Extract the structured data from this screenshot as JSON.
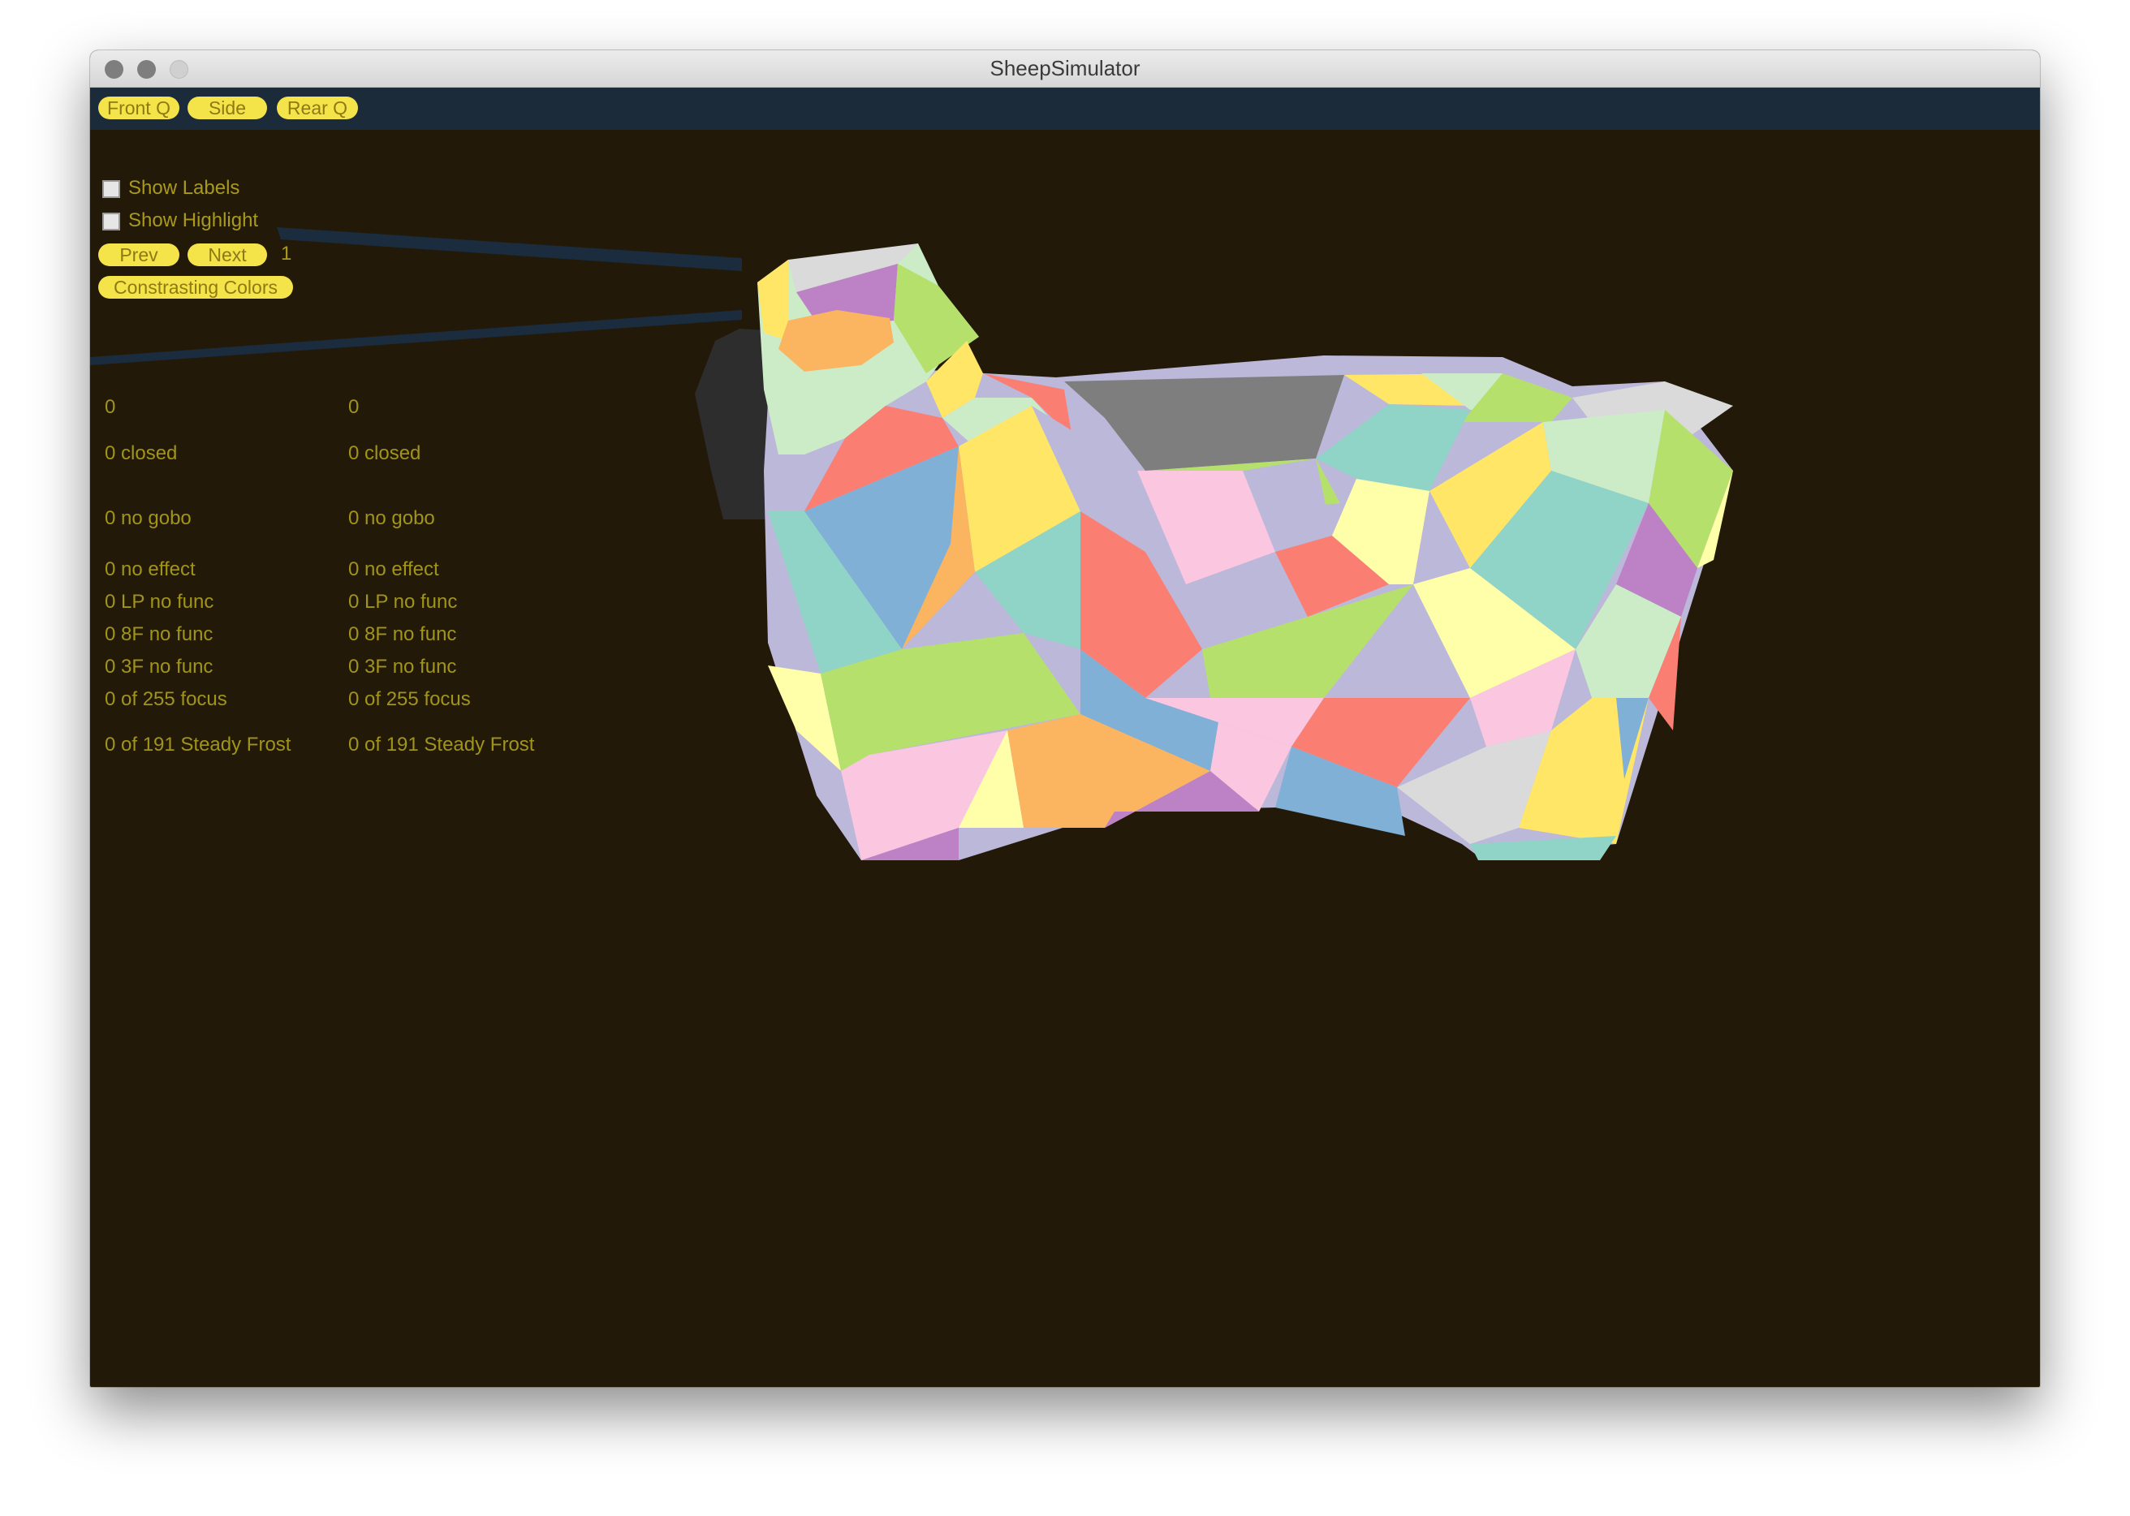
{
  "window": {
    "title": "SheepSimulator"
  },
  "toolbar": {
    "buttons": [
      "Front Q",
      "Side",
      "Rear Q"
    ]
  },
  "controls": {
    "show_labels": "Show Labels",
    "show_highlight": "Show Highlight",
    "prev": "Prev",
    "next": "Next",
    "page": "1",
    "contrasting_colors": "Constrasting Colors"
  },
  "fixtures": {
    "left": [
      "0",
      "0 closed",
      "0 no gobo",
      "0 no effect",
      "0 LP no func",
      "0 8F no func",
      "0 3F no func",
      "0 of 255 focus",
      "0 of 191 Steady Frost"
    ],
    "right": [
      "0",
      "0 closed",
      "0 no gobo",
      "0 no effect",
      "0 LP no func",
      "0 8F no func",
      "0 3F no func",
      "0 of 255 focus",
      "0 of 191 Steady Frost"
    ]
  },
  "colors": {
    "background": "#231909",
    "toolbar": "#1c2b3a",
    "button": "#f5e34a",
    "label_text": "#a89a1c"
  }
}
